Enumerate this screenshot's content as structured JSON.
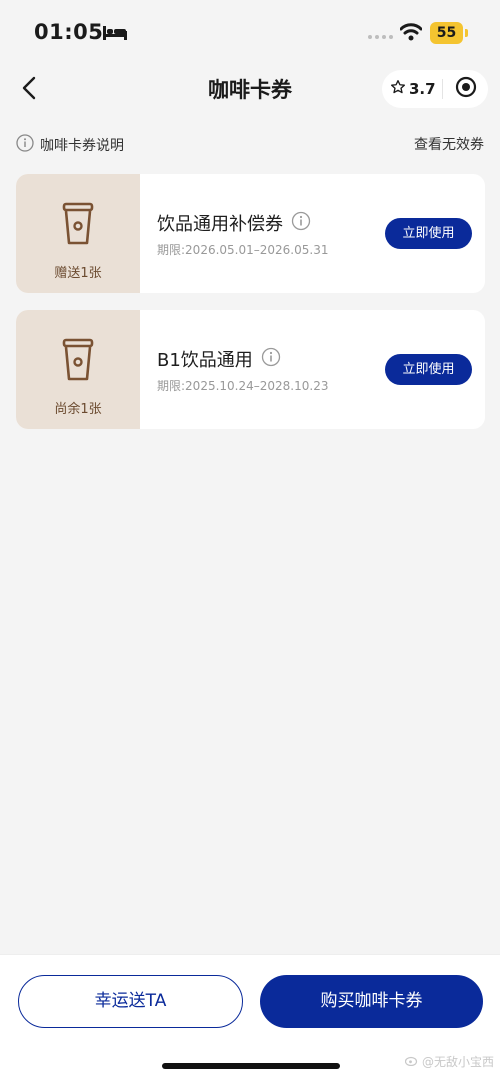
{
  "status_bar": {
    "time": "01:05",
    "battery": "55"
  },
  "nav": {
    "title": "咖啡卡券",
    "rating": "3.7"
  },
  "info": {
    "explain_label": "咖啡卡券说明",
    "invalid_label": "查看无效券"
  },
  "coupons": [
    {
      "name": "饮品通用补偿券",
      "validity": "期限:2026.05.01–2026.05.31",
      "count_label": "赠送1张",
      "button_label": "立即使用"
    },
    {
      "name": "B1饮品通用",
      "validity": "期限:2025.10.24–2028.10.23",
      "count_label": "尚余1张",
      "button_label": "立即使用"
    }
  ],
  "bottom": {
    "gift_label": "幸运送TA",
    "buy_label": "购买咖啡卡券"
  },
  "watermark": "@无敌小宝西",
  "colors": {
    "accent": "#0a2a9a",
    "coupon_stub": "#eae0d6",
    "cup_brown": "#7a5233",
    "battery": "#f4c430"
  },
  "icons": [
    "bed-icon",
    "wifi-icon",
    "back-arrow-icon",
    "star-icon",
    "target-icon",
    "info-icon",
    "coffee-cup-icon",
    "weibo-icon"
  ]
}
